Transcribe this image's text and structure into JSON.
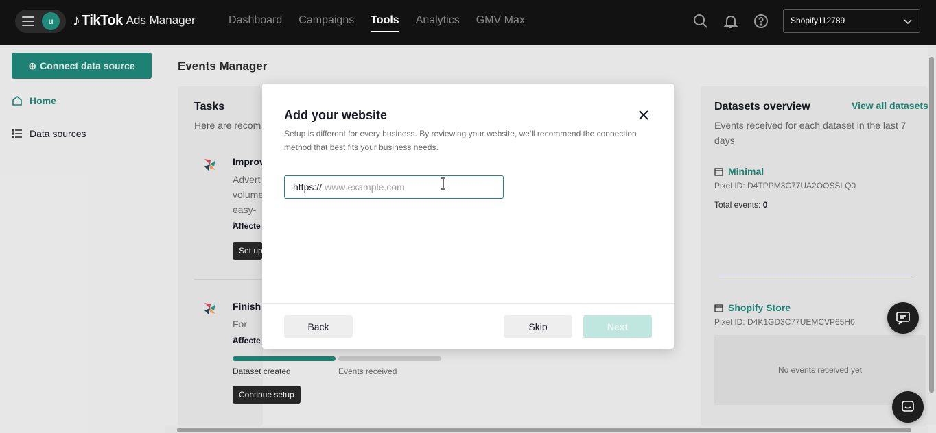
{
  "topbar": {
    "avatar_letter": "u",
    "brand_name": "TikTok",
    "brand_sub": "Ads Manager",
    "nav": [
      "Dashboard",
      "Campaigns",
      "Tools",
      "Analytics",
      "GMV Max"
    ],
    "active_nav": "Tools",
    "account": "Shopify112789"
  },
  "sidebar": {
    "connect_label": "Connect data source",
    "items": [
      {
        "label": "Home",
        "icon": "home-icon"
      },
      {
        "label": "Data sources",
        "icon": "list-icon"
      }
    ]
  },
  "page": {
    "title": "Events Manager"
  },
  "tasks": {
    "title": "Tasks",
    "subtitle": "Here are recom",
    "task1": {
      "title": "Improv",
      "text_lines": [
        "Advert",
        "volume",
        "easy-to"
      ],
      "affected": "Affecte",
      "button": "Set up"
    },
    "task2": {
      "title": "Finish",
      "text": "For act",
      "affected": "Affecte",
      "progress": [
        {
          "label": "Dataset created",
          "value": 1.0
        },
        {
          "label": "Events received",
          "value": 0.0
        }
      ],
      "button": "Continue setup"
    }
  },
  "datasets": {
    "title": "Datasets overview",
    "link": "View all datasets",
    "subtitle": "Events received for each dataset in the last 7 days",
    "items": [
      {
        "name": "Minimal",
        "pixel_id": "Pixel ID: D4TPPM3C77UA2OOSSLQ0",
        "total_label": "Total events:",
        "total_value": "0"
      },
      {
        "name": "Shopify Store",
        "pixel_id": "Pixel ID: D4K1GD3C77UEMCVP65H0",
        "empty_text": "No events received yet"
      }
    ]
  },
  "modal": {
    "title": "Add your website",
    "description": "Setup is different for every business. By reviewing your website, we'll recommend the connection method that best fits your business needs.",
    "url_prefix": "https://",
    "url_placeholder": "www.example.com",
    "url_value": "",
    "back_label": "Back",
    "skip_label": "Skip",
    "next_label": "Next"
  },
  "colors": {
    "brand": "#1f8a7a",
    "topbar": "#121212",
    "next_disabled": "#bfe6df"
  }
}
